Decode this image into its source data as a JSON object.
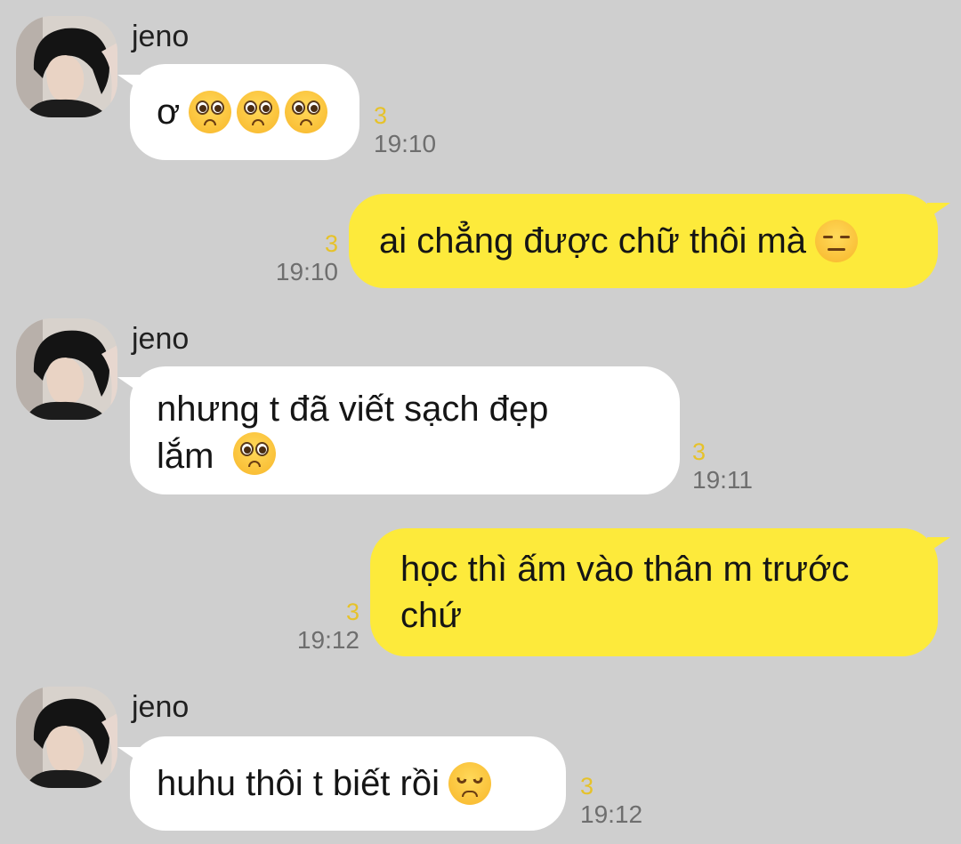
{
  "sender_name": "jeno",
  "messages": [
    {
      "text": "ơ",
      "unread": "3",
      "time": "19:10",
      "emoji": [
        "pleading-face",
        "pleading-face",
        "pleading-face"
      ]
    },
    {
      "text": "ai chẳng được chữ thôi mà",
      "unread": "3",
      "time": "19:10",
      "emoji": [
        "expressionless-face"
      ]
    },
    {
      "line1": "nhưng t đã viết sạch đẹp",
      "line2": "lắm",
      "unread": "3",
      "time": "19:11",
      "emoji": [
        "pleading-face"
      ]
    },
    {
      "line1": "học thì ấm vào thân m trước",
      "line2": "chứ",
      "unread": "3",
      "time": "19:12"
    },
    {
      "text": "huhu thôi t biết rồi",
      "unread": "3",
      "time": "19:12",
      "emoji": [
        "disappointed-face"
      ]
    }
  ],
  "colors": {
    "background": "#cfcfcf",
    "incoming_bubble": "#ffffff",
    "outgoing_bubble": "#fdea3b",
    "unread_count": "#e6c22a",
    "timestamp": "#6e6e6e"
  }
}
